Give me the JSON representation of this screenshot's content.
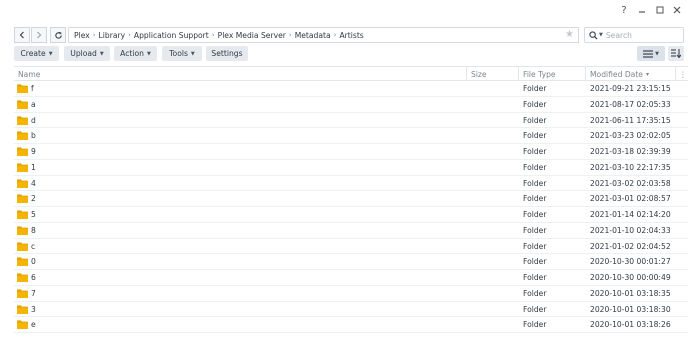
{
  "window": {
    "help_glyph": "?",
    "minimize_glyph": "—",
    "maximize_glyph": "□",
    "close_glyph": "✕"
  },
  "nav": {
    "breadcrumbs": [
      "Plex",
      "Library",
      "Application Support",
      "Plex Media Server",
      "Metadata",
      "Artists"
    ],
    "search_placeholder": "Search"
  },
  "toolbar": {
    "create": "Create",
    "upload": "Upload",
    "action": "Action",
    "tools": "Tools",
    "settings": "Settings"
  },
  "table": {
    "headers": {
      "name": "Name",
      "size": "Size",
      "type": "File Type",
      "modified": "Modified Date",
      "sort_indicator": "▾",
      "more": "⋮"
    },
    "rows": [
      {
        "name": "f",
        "type": "Folder",
        "modified": "2021-09-21 23:15:15"
      },
      {
        "name": "a",
        "type": "Folder",
        "modified": "2021-08-17 02:05:33"
      },
      {
        "name": "d",
        "type": "Folder",
        "modified": "2021-06-11 17:35:15"
      },
      {
        "name": "b",
        "type": "Folder",
        "modified": "2021-03-23 02:02:05"
      },
      {
        "name": "9",
        "type": "Folder",
        "modified": "2021-03-18 02:39:39"
      },
      {
        "name": "1",
        "type": "Folder",
        "modified": "2021-03-10 22:17:35"
      },
      {
        "name": "4",
        "type": "Folder",
        "modified": "2021-03-02 02:03:58"
      },
      {
        "name": "2",
        "type": "Folder",
        "modified": "2021-03-01 02:08:57"
      },
      {
        "name": "5",
        "type": "Folder",
        "modified": "2021-01-14 02:14:20"
      },
      {
        "name": "8",
        "type": "Folder",
        "modified": "2021-01-10 02:04:33"
      },
      {
        "name": "c",
        "type": "Folder",
        "modified": "2021-01-02 02:04:52"
      },
      {
        "name": "0",
        "type": "Folder",
        "modified": "2020-10-30 00:01:27"
      },
      {
        "name": "6",
        "type": "Folder",
        "modified": "2020-10-30 00:00:49"
      },
      {
        "name": "7",
        "type": "Folder",
        "modified": "2020-10-01 03:18:35"
      },
      {
        "name": "3",
        "type": "Folder",
        "modified": "2020-10-01 03:18:30"
      },
      {
        "name": "e",
        "type": "Folder",
        "modified": "2020-10-01 03:18:26"
      }
    ]
  },
  "colors": {
    "folder": "#f5b400",
    "folder_dark": "#e3a300",
    "button_bg": "#e6eaee",
    "active_view_bg": "#dbe2e9"
  }
}
